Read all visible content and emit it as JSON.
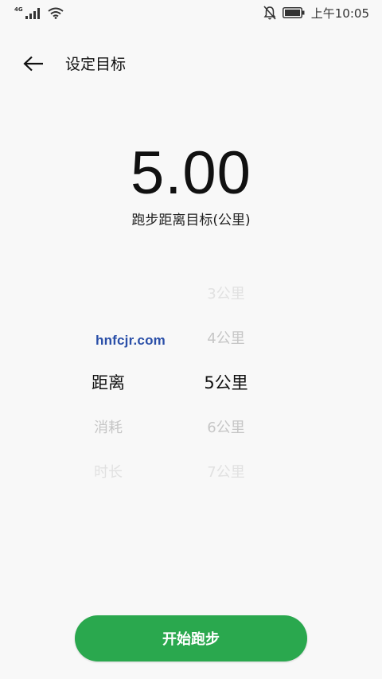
{
  "status_bar": {
    "network": "4G",
    "time": "上午10:05",
    "icons": [
      "signal-icon",
      "wifi-icon",
      "mute-bell-icon",
      "battery-icon"
    ]
  },
  "header": {
    "back_icon": "arrow-left-icon",
    "title": "设定目标"
  },
  "goal": {
    "value": "5.00",
    "label": "跑步距离目标(公里)"
  },
  "goal_type_picker": {
    "selected": "距离",
    "below": [
      "消耗",
      "时长"
    ]
  },
  "distance_picker": {
    "above": [
      "3公里",
      "4公里"
    ],
    "selected": "5公里",
    "below": [
      "6公里",
      "7公里"
    ]
  },
  "watermark": "hnfcjr.com",
  "start_button": {
    "label": "开始跑步"
  },
  "colors": {
    "accent": "#2aa84e",
    "background": "#f8f8f8",
    "watermark": "#2a4fa8"
  }
}
